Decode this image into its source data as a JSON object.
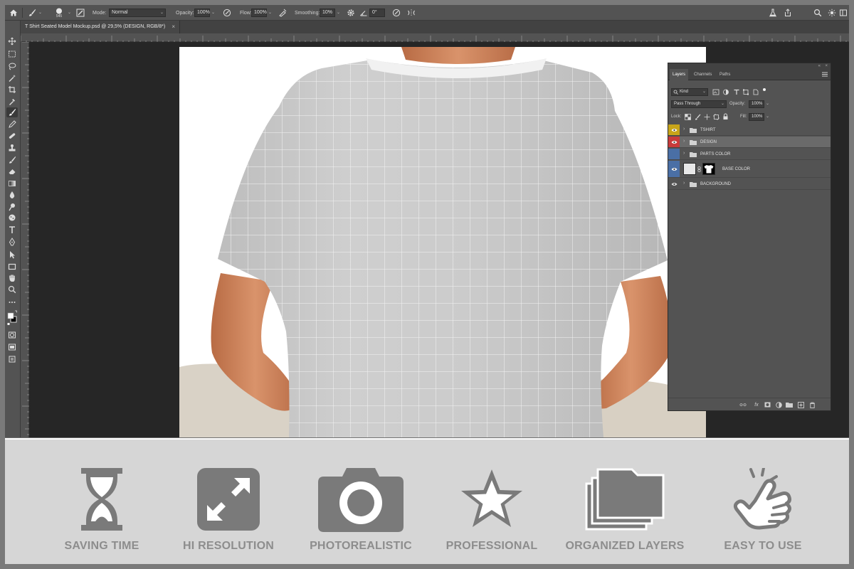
{
  "options_bar": {
    "brush_size": "545",
    "mode_label": "Mode:",
    "mode_value": "Normal",
    "opacity_label": "Opacity:",
    "opacity_value": "100%",
    "flow_label": "Flow:",
    "flow_value": "100%",
    "smoothing_label": "Smoothing:",
    "smoothing_value": "10%",
    "angle_value": "0°"
  },
  "document": {
    "tab_title": "T Shirt Seated Model Mockup.psd @ 29,5% (DESIGN, RGB/8*)",
    "tab_close": "×"
  },
  "layers_panel": {
    "collapse_glyph": "«",
    "close_glyph": "×",
    "tabs": [
      "Layers",
      "Channels",
      "Paths"
    ],
    "filter_value": "Kind",
    "blend_mode": "Pass Through",
    "opacity_label": "Opacity:",
    "opacity_value": "100%",
    "lock_label": "Lock:",
    "fill_label": "Fill:",
    "fill_value": "100%",
    "layers": [
      {
        "name": "TSHIRT",
        "tag_color": "#c8a51a",
        "visible": true
      },
      {
        "name": "DESIGN",
        "tag_color": "#c83b3b",
        "visible": true
      },
      {
        "name": "PARTS COLOR",
        "tag_color": "#4a6fa5",
        "visible": false
      },
      {
        "name": "BASE COLOR",
        "tag_color": "#4a6fa5",
        "visible": true
      },
      {
        "name": "BACKGROUND",
        "tag_color": "",
        "visible": true
      }
    ],
    "footer_link": "⊖⊖",
    "footer_fx": "fx"
  },
  "features": [
    {
      "label": "SAVING TIME",
      "icon": "hourglass-icon"
    },
    {
      "label": "HI RESOLUTION",
      "icon": "expand-arrows-icon"
    },
    {
      "label": "PHOTOREALISTIC",
      "icon": "camera-icon"
    },
    {
      "label": "PROFESSIONAL",
      "icon": "star-icon"
    },
    {
      "label": "ORGANIZED LAYERS",
      "icon": "stacked-folders-icon"
    },
    {
      "label": "EASY TO USE",
      "icon": "tap-hand-icon"
    }
  ],
  "colors": {
    "ui_dark": "#535353",
    "workspace": "#262626",
    "feature_grey": "#7a7a7a",
    "feature_label": "#8d8d8d"
  }
}
